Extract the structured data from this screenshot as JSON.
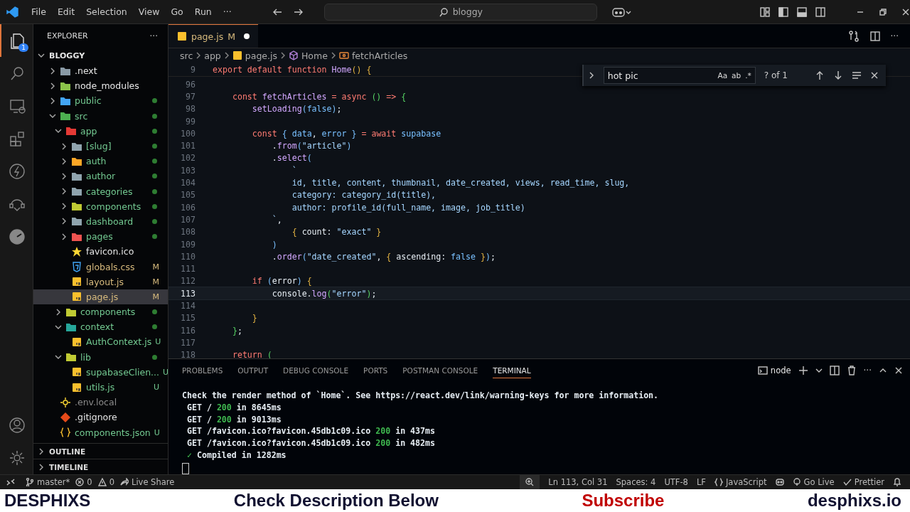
{
  "title_bar": {
    "menu": [
      "File",
      "Edit",
      "Selection",
      "View",
      "Go",
      "Run",
      "···"
    ],
    "search": {
      "value": "bloggy"
    }
  },
  "activity_bar": {
    "items": [
      {
        "kind": "files",
        "selected": true,
        "badge": "1"
      },
      {
        "kind": "search",
        "selected": false
      },
      {
        "kind": "remote",
        "selected": false
      },
      {
        "kind": "extensions",
        "selected": false
      },
      {
        "kind": "bolt",
        "selected": false
      },
      {
        "kind": "postman",
        "selected": false
      },
      {
        "kind": "gauge",
        "selected": false
      }
    ],
    "bottom": [
      {
        "kind": "account"
      },
      {
        "kind": "settings"
      }
    ]
  },
  "sidebar": {
    "title": "EXPLORER",
    "more": "···",
    "root": {
      "label": "BLOGGY",
      "expanded": true
    },
    "tree": [
      {
        "name": ".next",
        "kind": "folder",
        "expanded": false
      },
      {
        "name": "node_modules",
        "kind": "folder",
        "expanded": false
      },
      {
        "name": "public",
        "kind": "folder",
        "expanded": false,
        "dot": true
      },
      {
        "name": "src",
        "kind": "folder",
        "expanded": true,
        "dot": true,
        "children": [
          {
            "name": "app",
            "kind": "folder",
            "expanded": true,
            "dot": true,
            "children": [
              {
                "name": "[slug]",
                "kind": "folder",
                "expanded": false,
                "dot": true
              },
              {
                "name": "auth",
                "kind": "folder",
                "expanded": false,
                "dot": true
              },
              {
                "name": "author",
                "kind": "folder",
                "expanded": false,
                "dot": true
              },
              {
                "name": "categories",
                "kind": "folder",
                "expanded": false,
                "dot": true
              },
              {
                "name": "components",
                "kind": "folder",
                "expanded": false,
                "dot": true
              },
              {
                "name": "dashboard",
                "kind": "folder",
                "expanded": false,
                "dot": true
              },
              {
                "name": "pages",
                "kind": "folder",
                "expanded": false,
                "dot": true
              },
              {
                "name": "favicon.ico",
                "kind": "star"
              },
              {
                "name": "globals.css",
                "kind": "css",
                "badge": "M"
              },
              {
                "name": "layout.js",
                "kind": "js",
                "badge": "M"
              },
              {
                "name": "page.js",
                "kind": "js",
                "badge": "M",
                "selected": true
              }
            ]
          },
          {
            "name": "components",
            "kind": "folder",
            "expanded": false,
            "dot": true
          },
          {
            "name": "context",
            "kind": "folder",
            "expanded": true,
            "dot": true,
            "children": [
              {
                "name": "AuthContext.js",
                "kind": "js",
                "badge": "U"
              }
            ]
          },
          {
            "name": "lib",
            "kind": "folder",
            "expanded": true,
            "dot": true,
            "children": [
              {
                "name": "supabaseClien...",
                "kind": "js",
                "badge": "U"
              },
              {
                "name": "utils.js",
                "kind": "js",
                "badge": "U"
              }
            ]
          }
        ]
      },
      {
        "name": ".env.local",
        "kind": "gear",
        "ignored": true
      },
      {
        "name": ".gitignore",
        "kind": "git"
      },
      {
        "name": "components.json",
        "kind": "json",
        "badge": "U"
      }
    ],
    "sections": [
      {
        "label": "OUTLINE",
        "expanded": false
      },
      {
        "label": "TIMELINE",
        "expanded": false
      }
    ]
  },
  "editor": {
    "tabs": [
      {
        "label": "page.js",
        "badge": "M",
        "dirty": true,
        "selected": true
      }
    ],
    "breadcrumb": [
      {
        "label": "src",
        "kind": "folder"
      },
      {
        "label": "app",
        "kind": "folder"
      },
      {
        "label": "page.js",
        "kind": "js"
      },
      {
        "label": "Home",
        "kind": "component"
      },
      {
        "label": "fetchArticles",
        "kind": "variable"
      }
    ],
    "sticky": {
      "number": "9",
      "tokens": [
        {
          "kind": "kw",
          "text": "export default function "
        },
        {
          "kind": "fn",
          "text": "Home"
        },
        {
          "kind": "b1",
          "text": "() {"
        }
      ]
    },
    "find": {
      "value": "hot pic",
      "options": [
        "Aa",
        "ab",
        ".*"
      ],
      "result": "? of 1"
    },
    "lines": [
      {
        "number": "96"
      },
      {
        "number": "97",
        "tokens": [
          {
            "kind": "kw",
            "text": "    const "
          },
          {
            "kind": "fn",
            "text": "fetchArticles"
          },
          {
            "kind": "kw",
            "text": " = async "
          },
          {
            "kind": "b2",
            "text": "()"
          },
          {
            "kind": "kw",
            "text": " => "
          },
          {
            "kind": "b2",
            "text": "{"
          }
        ]
      },
      {
        "number": "98",
        "tokens": [
          {
            "kind": "fn",
            "text": "        setLoading"
          },
          {
            "kind": "b3",
            "text": "("
          },
          {
            "kind": "var",
            "text": "false"
          },
          {
            "kind": "b3",
            "text": ")"
          },
          {
            "kind": "p",
            "text": ";"
          }
        ]
      },
      {
        "number": "99"
      },
      {
        "number": "100",
        "tokens": [
          {
            "kind": "kw",
            "text": "        const "
          },
          {
            "kind": "b3",
            "text": "{ "
          },
          {
            "kind": "var",
            "text": "data"
          },
          {
            "kind": "p",
            "text": ", "
          },
          {
            "kind": "var",
            "text": "error"
          },
          {
            "kind": "b3",
            "text": " }"
          },
          {
            "kind": "kw",
            "text": " = await "
          },
          {
            "kind": "var",
            "text": "supabase"
          }
        ]
      },
      {
        "number": "101",
        "tokens": [
          {
            "kind": "p",
            "text": "            ."
          },
          {
            "kind": "fn",
            "text": "from"
          },
          {
            "kind": "b3",
            "text": "("
          },
          {
            "kind": "str",
            "text": "\"article\""
          },
          {
            "kind": "b3",
            "text": ")"
          }
        ]
      },
      {
        "number": "102",
        "tokens": [
          {
            "kind": "p",
            "text": "            ."
          },
          {
            "kind": "fn",
            "text": "select"
          },
          {
            "kind": "b3",
            "text": "("
          }
        ]
      },
      {
        "number": "103",
        "tokens": [
          {
            "kind": "str",
            "text": "                `"
          }
        ]
      },
      {
        "number": "104",
        "tokens": [
          {
            "kind": "str",
            "text": "                id, title, content, thumbnail, date_created, views, read_time, slug,"
          }
        ]
      },
      {
        "number": "105",
        "tokens": [
          {
            "kind": "str",
            "text": "                category: category_id(title),"
          }
        ]
      },
      {
        "number": "106",
        "tokens": [
          {
            "kind": "str",
            "text": "                author: profile_id(full_name, image, job_title)"
          }
        ]
      },
      {
        "number": "107",
        "tokens": [
          {
            "kind": "str",
            "text": "            `"
          },
          {
            "kind": "p",
            "text": ","
          }
        ]
      },
      {
        "number": "108",
        "tokens": [
          {
            "kind": "b1",
            "text": "                { "
          },
          {
            "kind": "p",
            "text": "count: "
          },
          {
            "kind": "str",
            "text": "\"exact\""
          },
          {
            "kind": "b1",
            "text": " }"
          }
        ]
      },
      {
        "number": "109",
        "tokens": [
          {
            "kind": "b3",
            "text": "            )"
          }
        ]
      },
      {
        "number": "110",
        "tokens": [
          {
            "kind": "p",
            "text": "            ."
          },
          {
            "kind": "fn",
            "text": "order"
          },
          {
            "kind": "b3",
            "text": "("
          },
          {
            "kind": "str",
            "text": "\"date_created\""
          },
          {
            "kind": "p",
            "text": ", "
          },
          {
            "kind": "b1",
            "text": "{ "
          },
          {
            "kind": "p",
            "text": "ascending: "
          },
          {
            "kind": "var",
            "text": "false"
          },
          {
            "kind": "b1",
            "text": " }"
          },
          {
            "kind": "b3",
            "text": ")"
          },
          {
            "kind": "p",
            "text": ";"
          }
        ]
      },
      {
        "number": "111"
      },
      {
        "number": "112",
        "tokens": [
          {
            "kind": "kw",
            "text": "        if "
          },
          {
            "kind": "b3",
            "text": "("
          },
          {
            "kind": "p",
            "text": "error"
          },
          {
            "kind": "b3",
            "text": ")"
          },
          {
            "kind": "b1",
            "text": " {"
          }
        ]
      },
      {
        "number": "113",
        "current": true,
        "tokens": [
          {
            "kind": "p",
            "text": "            console."
          },
          {
            "kind": "fn",
            "text": "log"
          },
          {
            "kind": "b2",
            "text": "("
          },
          {
            "kind": "str",
            "text": "\"error\""
          },
          {
            "kind": "b2",
            "text": ")"
          },
          {
            "kind": "p",
            "text": ";"
          }
        ]
      },
      {
        "number": "114"
      },
      {
        "number": "115",
        "tokens": [
          {
            "kind": "b1",
            "text": "        }"
          }
        ]
      },
      {
        "number": "116",
        "tokens": [
          {
            "kind": "b2",
            "text": "    }"
          },
          {
            "kind": "p",
            "text": ";"
          }
        ]
      },
      {
        "number": "117"
      },
      {
        "number": "118",
        "tokens": [
          {
            "kind": "kw",
            "text": "    return "
          },
          {
            "kind": "b2",
            "text": "("
          }
        ]
      }
    ]
  },
  "panel": {
    "tabs": [
      {
        "label": "PROBLEMS",
        "selected": false
      },
      {
        "label": "OUTPUT",
        "selected": false
      },
      {
        "label": "DEBUG CONSOLE",
        "selected": false
      },
      {
        "label": "PORTS",
        "selected": false
      },
      {
        "label": "POSTMAN CONSOLE",
        "selected": false
      },
      {
        "label": "TERMINAL",
        "selected": true
      }
    ],
    "shell": "node",
    "terminal": [
      [
        {
          "kind": "p",
          "text": "Check the render method of `Home`. See https://react.dev/link/warning-keys for more information."
        }
      ],
      [
        {
          "kind": "p",
          "text": " GET / "
        },
        {
          "kind": "ok",
          "text": "200"
        },
        {
          "kind": "p",
          "text": " in 8645ms"
        }
      ],
      [
        {
          "kind": "p",
          "text": " GET / "
        },
        {
          "kind": "ok",
          "text": "200"
        },
        {
          "kind": "p",
          "text": " in 9013ms"
        }
      ],
      [
        {
          "kind": "p",
          "text": " GET /favicon.ico?favicon.45db1c09.ico "
        },
        {
          "kind": "ok",
          "text": "200"
        },
        {
          "kind": "p",
          "text": " in 437ms"
        }
      ],
      [
        {
          "kind": "p",
          "text": " GET /favicon.ico?favicon.45db1c09.ico "
        },
        {
          "kind": "ok",
          "text": "200"
        },
        {
          "kind": "p",
          "text": " in 482ms"
        }
      ],
      [
        {
          "kind": "ok",
          "text": " ✓"
        },
        {
          "kind": "p",
          "text": " Compiled in 1282ms"
        }
      ]
    ]
  },
  "status_bar": {
    "left": [
      {
        "kind": "branch",
        "text": "master*"
      },
      {
        "kind": "errors",
        "text": "0"
      },
      {
        "kind": "warnings",
        "text": "0"
      },
      {
        "kind": "share",
        "text": "Live Share"
      }
    ],
    "right": [
      {
        "kind": "zoom"
      },
      {
        "kind": "text",
        "text": "Ln 113, Col 31"
      },
      {
        "kind": "text",
        "text": "Spaces: 4"
      },
      {
        "kind": "text",
        "text": "UTF-8"
      },
      {
        "kind": "text",
        "text": "LF"
      },
      {
        "kind": "braces",
        "text": "JavaScript"
      },
      {
        "kind": "copilot"
      },
      {
        "kind": "live",
        "text": "Go Live"
      },
      {
        "kind": "check",
        "text": "Prettier"
      },
      {
        "kind": "bell"
      }
    ]
  },
  "banner": [
    {
      "text": "DESPHIXS",
      "kind": "brand"
    },
    {
      "text": "Check Description Below",
      "kind": "brand"
    },
    {
      "text": "Subscribe",
      "kind": "alert"
    },
    {
      "text": "desphixs.io",
      "kind": "brand"
    }
  ]
}
